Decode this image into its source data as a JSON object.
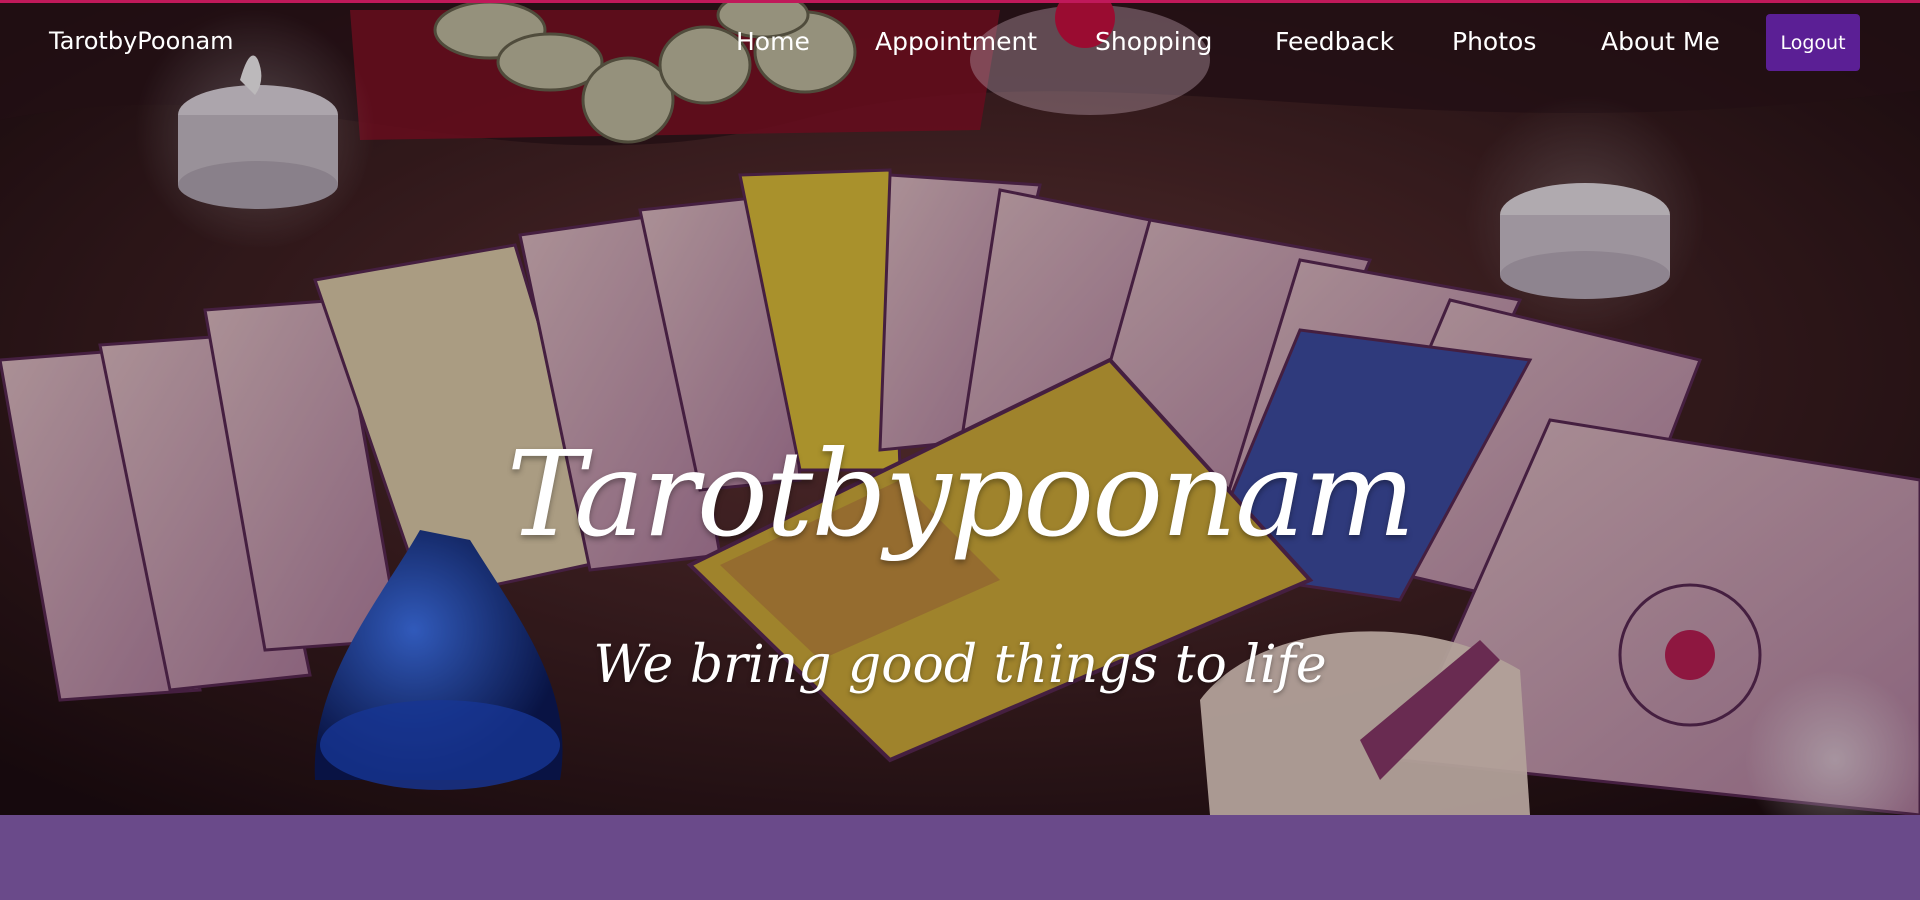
{
  "nav": {
    "brand": "TarotbyPoonam",
    "items": [
      {
        "label": "Home"
      },
      {
        "label": "Appointment"
      },
      {
        "label": "Shopping"
      },
      {
        "label": "Feedback"
      },
      {
        "label": "Photos"
      },
      {
        "label": "About Me"
      }
    ],
    "logout": "Logout"
  },
  "hero": {
    "title": "Tarotbypoonam",
    "subtitle": "We bring good things to life",
    "image": "tarot-cards-candles-background"
  },
  "colors": {
    "accent_line": "#c0195a",
    "logout_bg": "#5b1f95",
    "footer_band": "#6a4a8a"
  }
}
